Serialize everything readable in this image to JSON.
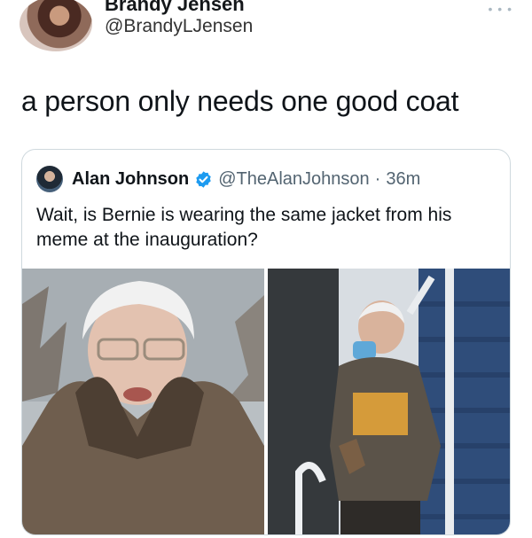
{
  "tweet": {
    "author_name": "Brandy Jensen",
    "author_handle": "@BrandyLJensen",
    "text": "a person only needs one good coat"
  },
  "quote": {
    "author_name": "Alan Johnson",
    "author_handle": "@TheAlanJohnson",
    "separator": "·",
    "time": "36m",
    "text": "Wait, is Bernie is wearing the same jacket from his meme at the inauguration?",
    "verified": true
  },
  "icons": {
    "more": "more-icon",
    "verified": "verified-badge-icon"
  },
  "colors": {
    "verified": "#1d9bf0",
    "secondary_text": "#536471",
    "border": "#cfd9de"
  }
}
